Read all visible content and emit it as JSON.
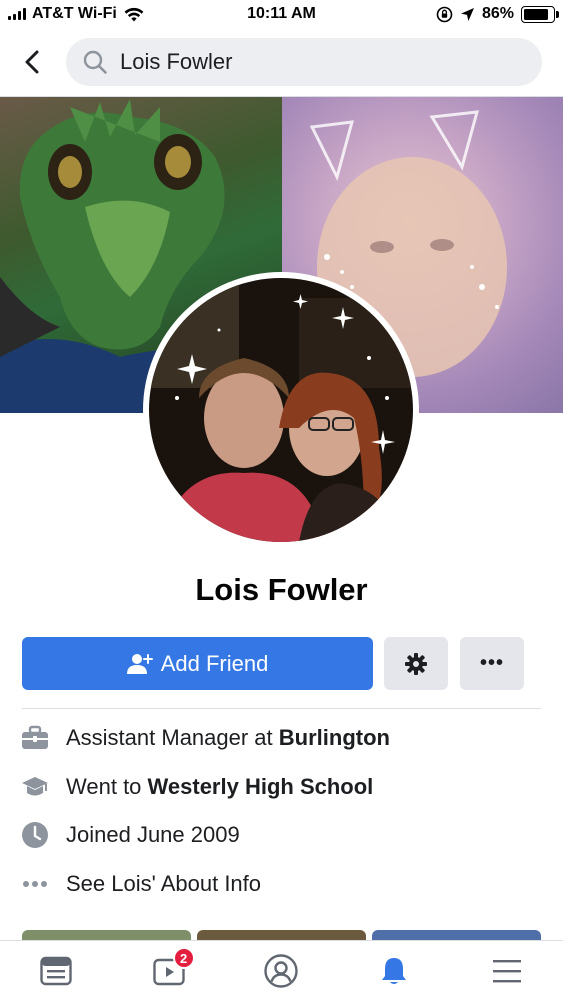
{
  "status_bar": {
    "carrier": "AT&T Wi-Fi",
    "time": "10:11 AM",
    "battery": "86%",
    "battery_level": 0.86
  },
  "search": {
    "query": "Lois Fowler",
    "icon": "search-icon"
  },
  "profile": {
    "name": "Lois Fowler"
  },
  "actions": {
    "add_friend_label": "Add Friend",
    "more_label": "•••"
  },
  "info": {
    "work_prefix": "Assistant Manager at ",
    "work_place": "Burlington",
    "school_prefix": "Went to ",
    "school_name": "Westerly High School",
    "joined": "Joined June 2009",
    "about": "See Lois' About Info"
  },
  "tabs": {
    "items": [
      "news-feed-icon",
      "watch-icon",
      "profile-icon",
      "notifications-icon",
      "menu-icon"
    ],
    "watch_badge": "2"
  },
  "colors": {
    "primary_button": "#3578e5",
    "secondary_button": "#e4e6eb",
    "badge": "#e41e3f"
  }
}
